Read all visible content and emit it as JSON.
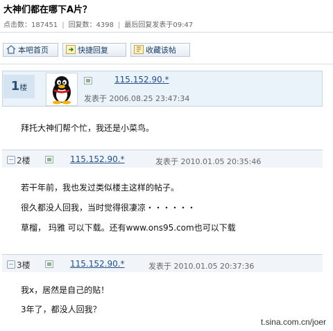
{
  "thread": {
    "title": "大神们都在哪下A片？",
    "views_label": "点击数：187451",
    "replies_label": "回复数：4398",
    "last_reply_label": "最后回复发表于09:47"
  },
  "toolbar": {
    "home_label": "本吧首页",
    "quick_reply_label": "快捷回复",
    "favorite_label": "收藏该帖"
  },
  "posts": [
    {
      "floor": "1",
      "floor_unit": "楼",
      "ip": "115.152.90.*",
      "time": "发表于 2006.08.25 23:47:34",
      "lines": [
        "拜托大神们帮个忙，我还是小菜鸟。"
      ]
    },
    {
      "floor": "2楼",
      "ip": "115.152.90.*",
      "time": "发表于 2010.01.05 20:35:46",
      "lines": [
        "若干年前，我也发过类似楼主这样的帖子。",
        "很久都没人回我，当时觉得很凄凉・・・・・・",
        "草榴， 玛雅   可以下载。还有www.ons95.com也可以下载"
      ]
    },
    {
      "floor": "3楼",
      "ip": "115.152.90.*",
      "time": "发表于 2010.01.05 20:37:36",
      "lines": [
        "我x，居然是自己的贴！",
        "3年了，都没人回我？"
      ]
    }
  ],
  "watermark": "t.sina.com.cn/joer",
  "colors": {
    "link": "#1f4e8c",
    "header_bg": "#eaf2fa",
    "border": "#c9d6e2"
  }
}
